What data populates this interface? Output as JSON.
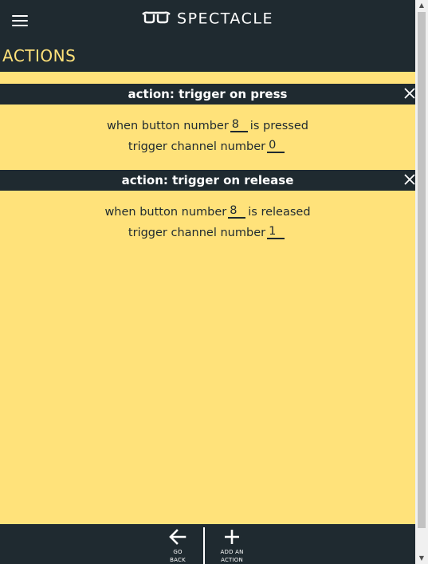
{
  "header": {
    "brand": "SPECTACLE",
    "section_title": "ACTIONS"
  },
  "actions": [
    {
      "title": "action: trigger on press",
      "line1_prefix": "when button number",
      "button_number": "8",
      "line1_suffix": "is pressed",
      "line2_prefix": "trigger channel number",
      "channel_number": "0"
    },
    {
      "title": "action: trigger on release",
      "line1_prefix": "when button number",
      "button_number": "8",
      "line1_suffix": "is released",
      "line2_prefix": "trigger channel number",
      "channel_number": "1"
    }
  ],
  "footer": {
    "go_back_line1": "GO",
    "go_back_line2": "BACK",
    "add_action_line1": "ADD AN",
    "add_action_line2": "ACTION"
  },
  "icons": {
    "menu": "hamburger-menu-icon",
    "brand": "glasses-icon",
    "close": "close-icon",
    "back": "arrow-left-icon",
    "add": "plus-icon"
  },
  "colors": {
    "dark": "#1f2a30",
    "accent": "#ffe27a",
    "text_light": "#ffffff"
  }
}
